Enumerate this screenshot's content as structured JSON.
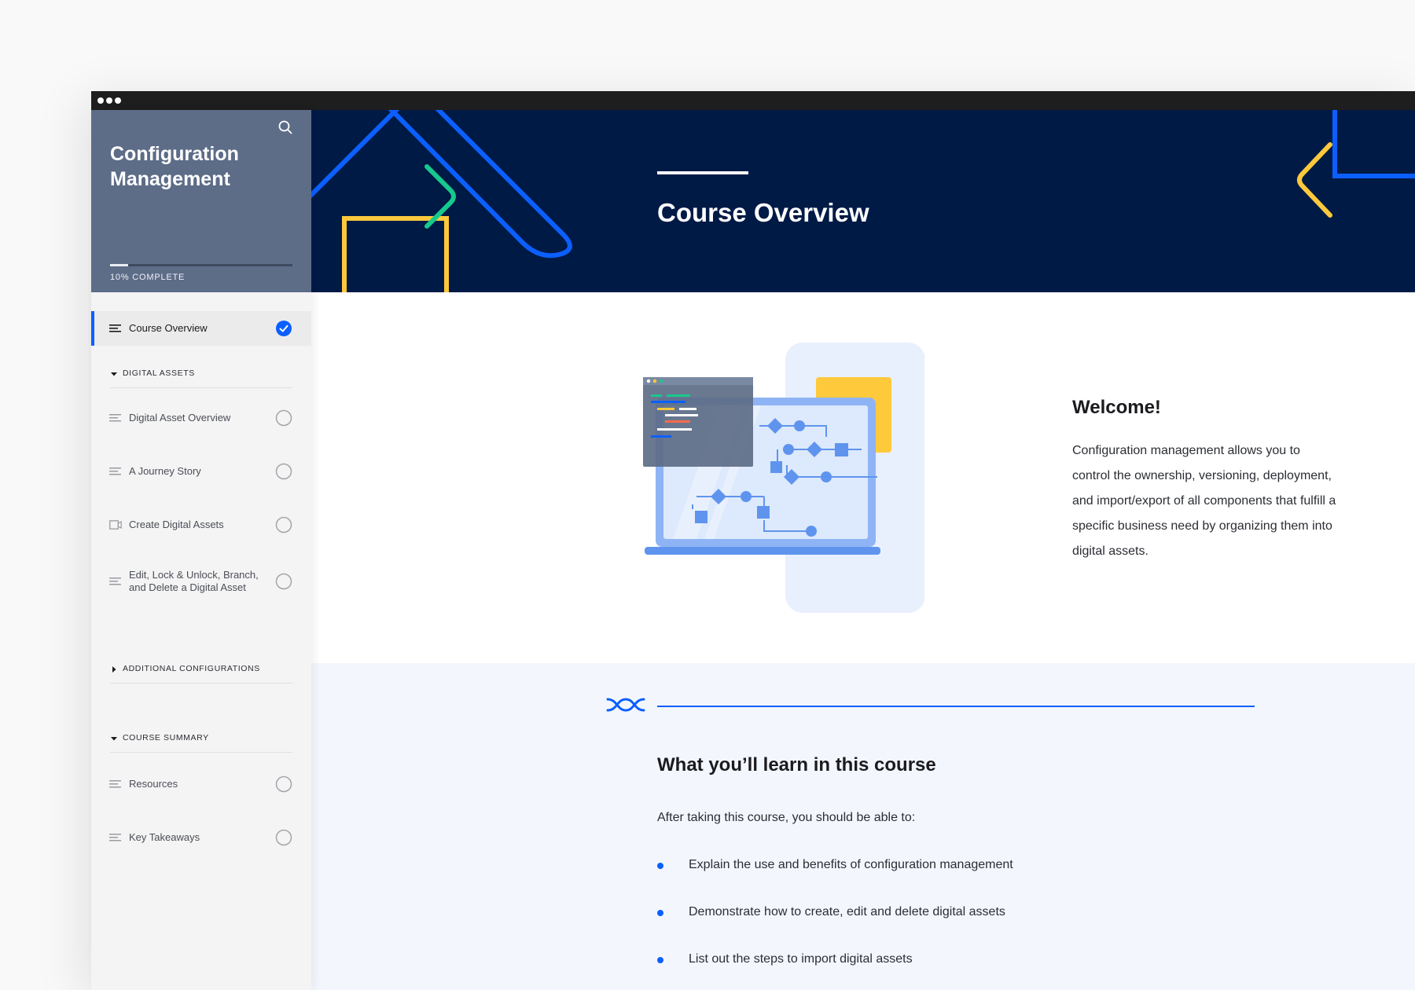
{
  "course": {
    "title": "Configuration Management",
    "progress_percent": 10,
    "progress_label": "10% COMPLETE"
  },
  "sidebar": {
    "active_item": {
      "label": "Course Overview",
      "icon": "list-icon",
      "status": "complete"
    },
    "sections": [
      {
        "label": "DIGITAL ASSETS",
        "expanded": true,
        "items": [
          {
            "label": "Digital Asset Overview",
            "icon": "list-icon",
            "status": "incomplete"
          },
          {
            "label": "A Journey Story",
            "icon": "list-icon",
            "status": "incomplete"
          },
          {
            "label": "Create Digital Assets",
            "icon": "video-icon",
            "status": "incomplete"
          },
          {
            "label": "Edit, Lock & Unlock, Branch, and Delete a Digital Asset",
            "icon": "list-icon",
            "status": "incomplete"
          }
        ]
      },
      {
        "label": "ADDITIONAL CONFIGURATIONS",
        "expanded": false,
        "items": []
      },
      {
        "label": "COURSE SUMMARY",
        "expanded": true,
        "items": [
          {
            "label": "Resources",
            "icon": "list-icon",
            "status": "incomplete"
          },
          {
            "label": "Key Takeaways",
            "icon": "list-icon",
            "status": "incomplete"
          }
        ]
      }
    ]
  },
  "banner": {
    "title": "Course Overview"
  },
  "welcome": {
    "title": "Welcome!",
    "text": "Configuration management allows you to control the ownership, versioning, deployment, and import/export of all components that fulfill a specific business need by organizing them into digital assets."
  },
  "learn": {
    "title": "What you’ll learn in this course",
    "intro": "After taking this course, you should be able to:",
    "items": [
      "Explain the use and benefits of configuration management",
      "Demonstrate how to create, edit and delete digital assets",
      "List out the steps to import digital assets"
    ]
  },
  "colors": {
    "accent": "#0b5fff",
    "sidebar_header": "#5d6c87",
    "banner": "#001a46",
    "art_yellow": "#ffc93c",
    "art_green": "#16c98d",
    "learn_background": "#f3f7fd"
  }
}
